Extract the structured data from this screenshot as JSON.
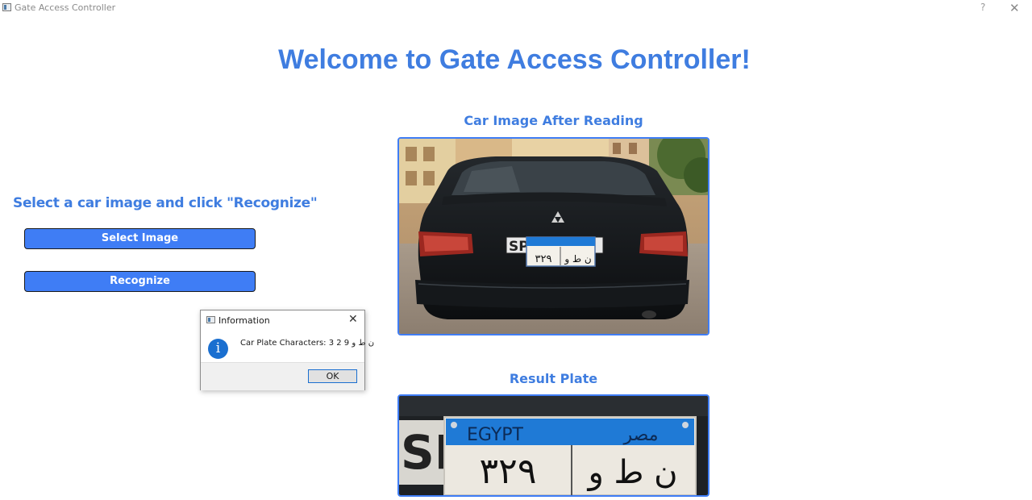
{
  "window": {
    "title": "Gate Access Controller",
    "help_glyph": "?",
    "close_glyph": "✕",
    "icon": "app-window-icon"
  },
  "main": {
    "welcome_title": "Welcome to Gate Access Controller!",
    "instruction": "Select a car image and click \"Recognize\"",
    "select_button_label": "Select Image",
    "recognize_button_label": "Recognize",
    "car_image_label": "Car Image After Reading",
    "result_plate_label": "Result Plate"
  },
  "plate": {
    "country_en": "EGYPT",
    "country_ar": "مصر",
    "digits_ar": "٣٢٩",
    "letters_ar": "ن ط و",
    "overlay_en_partial": "SP"
  },
  "dialog": {
    "title": "Information",
    "close_glyph": "✕",
    "info_glyph": "i",
    "message": "Car Plate Characters: 3 2 9 ن ط و",
    "ok_label": "OK"
  },
  "colors": {
    "accent": "#3f7de0",
    "button_fill": "#3f7df5",
    "plate_blue": "#1f7ad6",
    "info_blue": "#1a6fd0"
  }
}
